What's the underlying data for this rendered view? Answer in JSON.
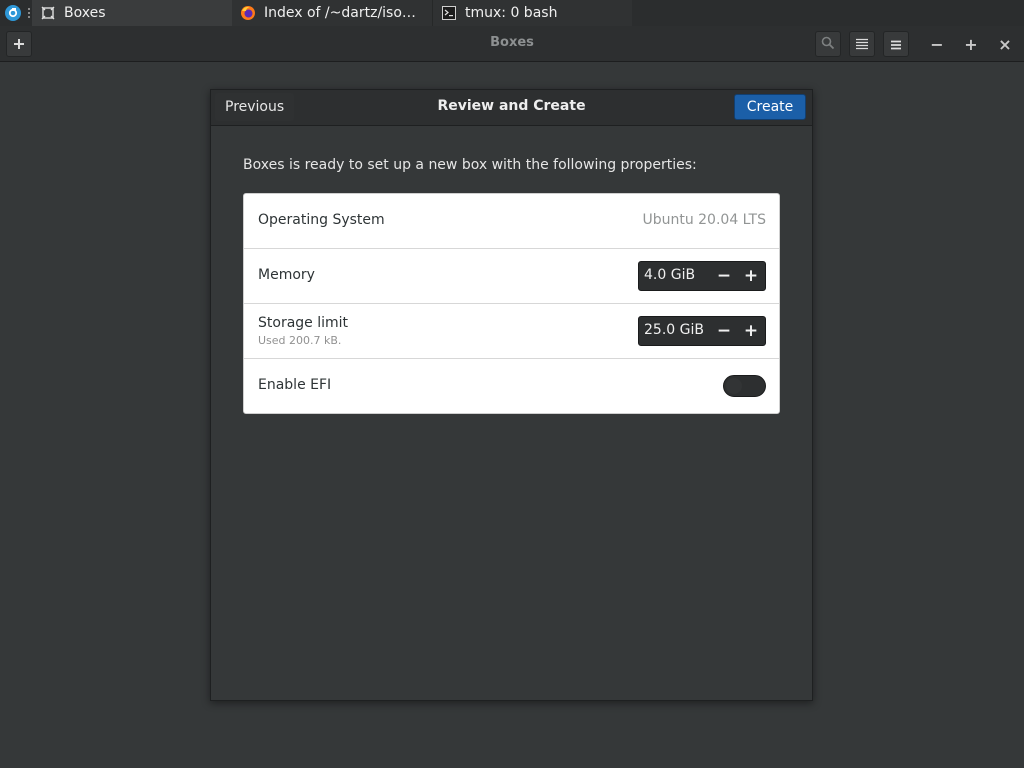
{
  "taskbar": {
    "tasks": [
      {
        "label": "Boxes",
        "icon": "boxes-app-icon"
      },
      {
        "label": "Index of /~dartz/isos/ —...",
        "icon": "firefox-icon"
      },
      {
        "label": "tmux: 0 bash",
        "icon": "terminal-icon"
      }
    ]
  },
  "headerbar": {
    "title": "Boxes",
    "new_icon": "plus-icon",
    "search_icon": "search-icon",
    "list_view_icon": "list-view-icon",
    "menu_icon": "hamburger-menu-icon",
    "minimize": "−",
    "maximize": "+",
    "close": "×"
  },
  "dialog": {
    "previous_label": "Previous",
    "title": "Review and Create",
    "create_label": "Create",
    "intro": "Boxes is ready to set up a new box with the following properties:",
    "properties": {
      "os_label": "Operating System",
      "os_value": "Ubuntu 20.04 LTS",
      "memory_label": "Memory",
      "memory_value": "4.0 GiB",
      "storage_label": "Storage limit",
      "storage_sub": "Used 200.7 kB.",
      "storage_value": "25.0 GiB",
      "efi_label": "Enable EFI",
      "efi_enabled": false,
      "decrement": "−",
      "increment": "+"
    }
  },
  "colors": {
    "accent": "#1b5fa8",
    "background": "#353839",
    "header": "#2d2f30"
  }
}
